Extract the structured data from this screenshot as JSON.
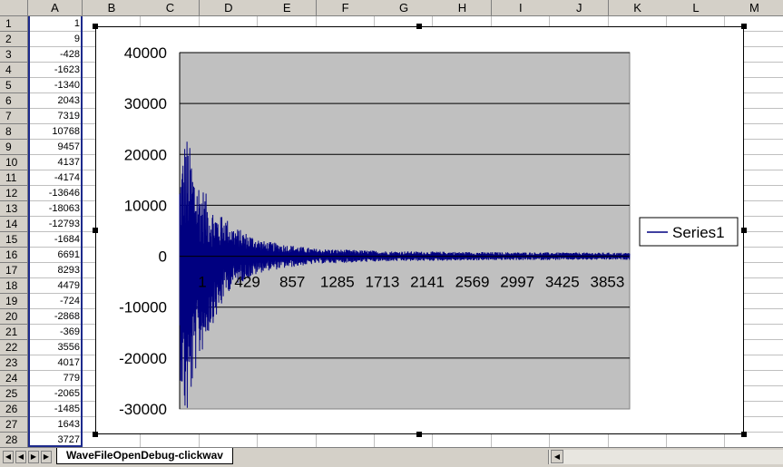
{
  "sheet": {
    "columns": [
      "A",
      "B",
      "C",
      "D",
      "E",
      "F",
      "G",
      "H",
      "I",
      "J",
      "K",
      "L",
      "M"
    ],
    "rows": [
      1,
      2,
      3,
      4,
      5,
      6,
      7,
      8,
      9,
      10,
      11,
      12,
      13,
      14,
      15,
      16,
      17,
      18,
      19,
      20,
      21,
      22,
      23,
      24,
      25,
      26,
      27,
      28
    ],
    "column_a": [
      "1",
      "9",
      "-428",
      "-1623",
      "-1340",
      "2043",
      "7319",
      "10768",
      "9457",
      "4137",
      "-4174",
      "-13646",
      "-18063",
      "-12793",
      "-1684",
      "6691",
      "8293",
      "4479",
      "-724",
      "-2868",
      "-369",
      "3556",
      "4017",
      "779",
      "-2065",
      "-1485",
      "1643",
      "3727"
    ],
    "tab_name": "WaveFileOpenDebug-clickwav"
  },
  "chart_data": {
    "type": "line",
    "ylim": [
      -30000,
      40000
    ],
    "yticks": [
      "40000",
      "30000",
      "20000",
      "10000",
      "0",
      "-10000",
      "-20000",
      "-30000"
    ],
    "xticks": [
      "1",
      "429",
      "857",
      "1285",
      "1713",
      "2141",
      "2569",
      "2997",
      "3425",
      "3853"
    ],
    "x_count": 4281,
    "series": [
      {
        "name": "Series1",
        "color": "#000080"
      }
    ],
    "plot_background": "#c0c0c0",
    "grid": true,
    "legend_position": "right",
    "envelope": [
      {
        "x": 1,
        "amp": 20000
      },
      {
        "x": 60,
        "amp": 29500
      },
      {
        "x": 150,
        "amp": 20000
      },
      {
        "x": 300,
        "amp": 12000
      },
      {
        "x": 500,
        "amp": 6000
      },
      {
        "x": 800,
        "amp": 3000
      },
      {
        "x": 1285,
        "amp": 1500
      },
      {
        "x": 2000,
        "amp": 1000
      },
      {
        "x": 3000,
        "amp": 800
      },
      {
        "x": 4281,
        "amp": 700
      }
    ]
  },
  "colors": {
    "selection": "#1d2a8c",
    "header": "#d4d0c8"
  }
}
